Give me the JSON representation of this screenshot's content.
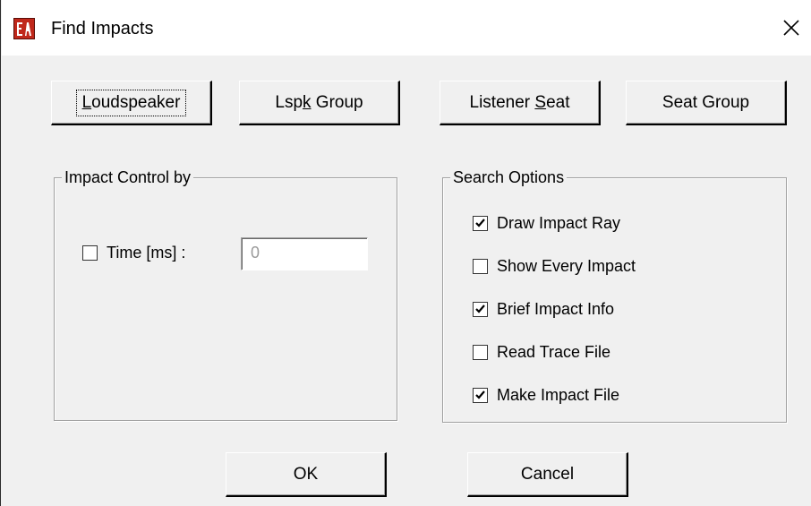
{
  "window": {
    "title": "Find Impacts",
    "icon": "app-logo-icon"
  },
  "top_buttons": [
    {
      "label_pre": "",
      "mnemonic": "L",
      "label_post": "oudspeaker"
    },
    {
      "label_pre": "Lsp",
      "mnemonic": "k",
      "label_post": " Group"
    },
    {
      "label_pre": "Listener ",
      "mnemonic": "S",
      "label_post": "eat"
    },
    {
      "label_pre": "Seat Group",
      "mnemonic": "",
      "label_post": ""
    }
  ],
  "impact_control": {
    "label": "Impact Control by",
    "time_label": "Time [ms] :",
    "time_checked": false,
    "time_value": "0"
  },
  "search_options": {
    "label": "Search Options",
    "items": [
      {
        "label": "Draw Impact Ray",
        "checked": true
      },
      {
        "label": "Show Every Impact",
        "checked": false
      },
      {
        "label": "Brief Impact Info",
        "checked": true
      },
      {
        "label": "Read Trace File",
        "checked": false
      },
      {
        "label": "Make Impact File",
        "checked": true
      }
    ]
  },
  "footer": {
    "ok_label": "OK",
    "cancel_label": "Cancel"
  }
}
